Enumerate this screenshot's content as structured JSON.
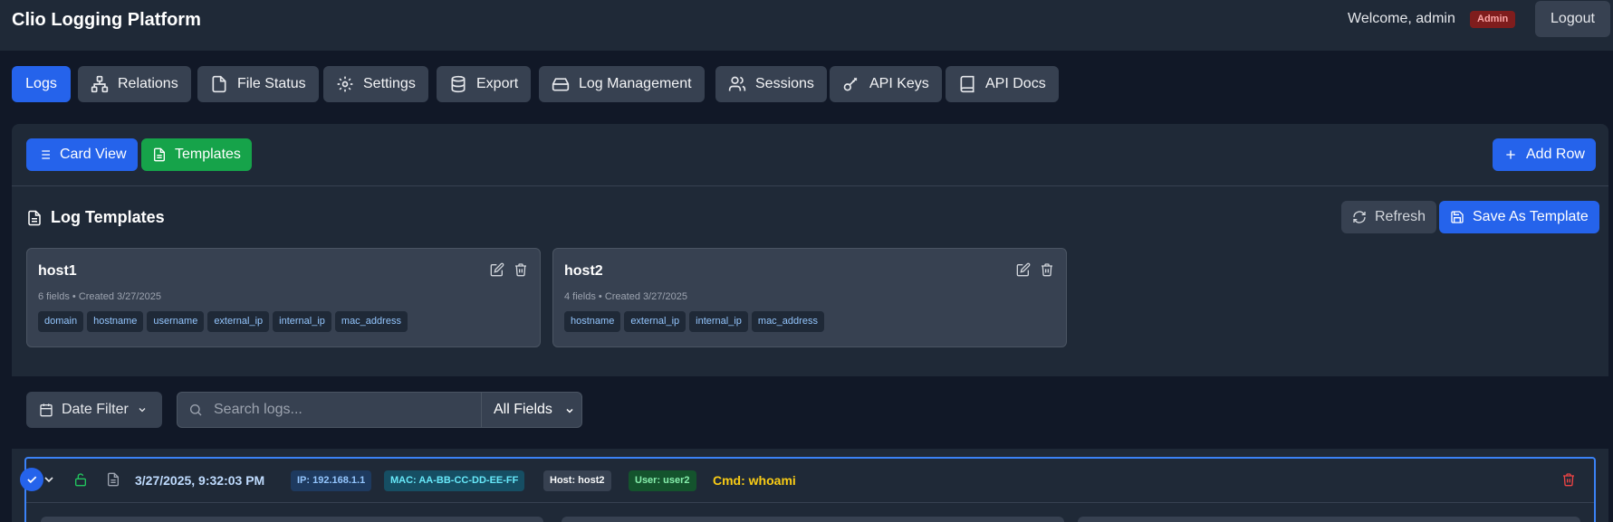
{
  "app": {
    "title": "Clio Logging Platform",
    "welcome": "Welcome, admin",
    "role_badge": "Admin",
    "logout_label": "Logout"
  },
  "nav": {
    "tabs": [
      {
        "label": "Logs",
        "icon": "none",
        "active": true
      },
      {
        "label": "Relations",
        "icon": "network-icon"
      },
      {
        "label": "File Status",
        "icon": "file-icon"
      },
      {
        "label": "Settings",
        "icon": "gear-icon"
      },
      {
        "label": "Export",
        "icon": "database-icon"
      },
      {
        "label": "Log Management",
        "icon": "hard-drive-icon"
      },
      {
        "label": "Sessions",
        "icon": "users-icon"
      },
      {
        "label": "API Keys",
        "icon": "key-icon"
      },
      {
        "label": "API Docs",
        "icon": "book-icon"
      }
    ]
  },
  "toolbar": {
    "card_view_label": "Card View",
    "templates_label": "Templates",
    "add_row_label": "Add Row"
  },
  "templates": {
    "section_title": "Log Templates",
    "refresh_label": "Refresh",
    "save_as_template_label": "Save As Template",
    "items": [
      {
        "name": "host1",
        "meta": "6 fields • Created 3/27/2025",
        "fields": [
          "domain",
          "hostname",
          "username",
          "external_ip",
          "internal_ip",
          "mac_address"
        ]
      },
      {
        "name": "host2",
        "meta": "4 fields • Created 3/27/2025",
        "fields": [
          "hostname",
          "external_ip",
          "internal_ip",
          "mac_address"
        ]
      }
    ]
  },
  "filters": {
    "date_filter_label": "Date Filter",
    "search_placeholder": "Search logs...",
    "field_select_value": "All Fields"
  },
  "log_row": {
    "timestamp": "3/27/2025, 9:32:03 PM",
    "ip": "IP: 192.168.1.1",
    "mac": "MAC: AA-BB-CC-DD-EE-FF",
    "host": "Host: host2",
    "user": "User: user2",
    "cmd": "Cmd: whoami"
  },
  "colors": {
    "accent": "#2563eb",
    "success": "#16a34a",
    "danger": "#ef4444",
    "background": "#111827",
    "surface": "#1f2937"
  }
}
